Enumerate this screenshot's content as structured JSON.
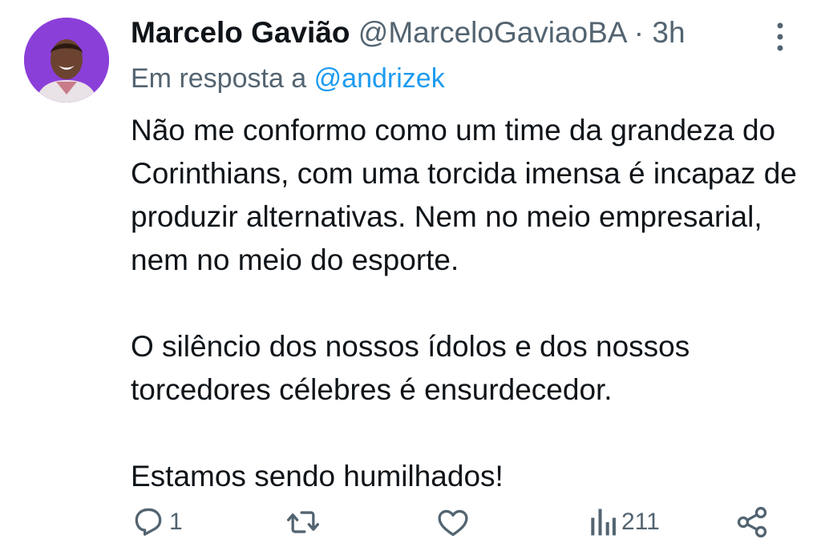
{
  "tweet": {
    "author_name": "Marcelo Gavião",
    "author_handle": "@MarceloGaviaoBA",
    "separator": "·",
    "timestamp": "3h",
    "reply_prefix": "Em resposta a",
    "reply_mention": "@andrizek",
    "paragraphs": [
      "Não me conformo como um time da grandeza do Corinthians, com uma torcida imensa é incapaz de produzir alternativas. Nem no meio empresarial, nem no meio do esporte.",
      "O silêncio dos nossos ídolos e dos nossos torcedores célebres é ensurdecedor.",
      "Estamos sendo humilhados!"
    ]
  },
  "actions": {
    "reply": {
      "icon": "reply-icon",
      "count": "1"
    },
    "retweet": {
      "icon": "retweet-icon",
      "count": ""
    },
    "like": {
      "icon": "heart-icon",
      "count": ""
    },
    "views": {
      "icon": "views-icon",
      "count": "211"
    },
    "share": {
      "icon": "share-icon"
    }
  },
  "colors": {
    "avatar_bg": "#8b3fd9",
    "text_primary": "#0f1419",
    "text_secondary": "#536471",
    "mention": "#1d9bf0"
  }
}
